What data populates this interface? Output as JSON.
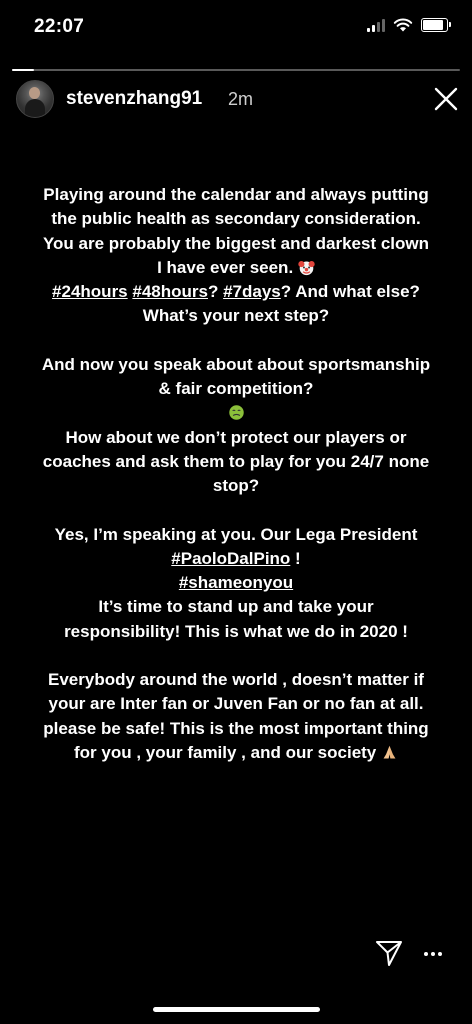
{
  "status_bar": {
    "time": "22:07",
    "battery_level": 0.85,
    "signal_bars": 2
  },
  "story": {
    "progress": 0.05
  },
  "header": {
    "username": "stevenzhang91",
    "posted": "2m"
  },
  "icons": {
    "close": "close-icon",
    "send": "send-icon",
    "more": "more-dots-icon",
    "clown": "clown-face-emoji",
    "nauseated": "nauseated-face-emoji",
    "pray": "folded-hands-emoji"
  },
  "text": {
    "p1_a": "Playing around the calendar and always putting the public health as secondary consideration. You are probably the biggest and darkest clown I have ever seen.",
    "p1_tag1": "#24hours",
    "p1_tag2": "#48hours",
    "p1_q1": "?",
    "p1_tag3": "#7days",
    "p1_q2": "?",
    "p1_b": "And what else?  What’s your next step?",
    "p2_a": "And now you speak about about sportsmanship & fair competition?",
    "p2_b": "How about we don’t protect our players or coaches and ask them to play for you 24/7 none stop?",
    "p3_a": "Yes, I’m speaking at you. Our Lega President",
    "p3_tag1": "#PaoloDalPino",
    "p3_excl": "!",
    "p3_tag2": "#shameonyou",
    "p3_b": "It’s time to stand up and take your responsibility!  This is what we do in 2020 !",
    "p4": "Everybody around the world , doesn’t matter if your are Inter fan or Juven Fan or no fan at all. please be safe! This is the most important thing for you , your family , and our society"
  }
}
